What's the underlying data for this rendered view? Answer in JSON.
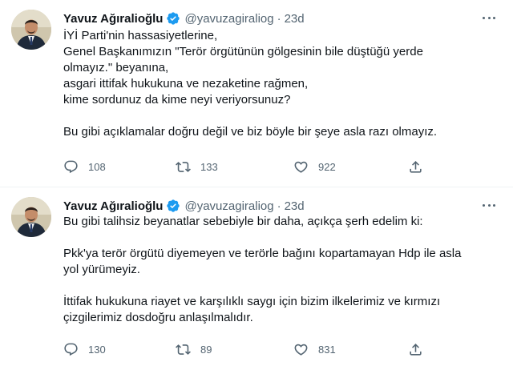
{
  "accent_color": "#1d9bf0",
  "tweets": [
    {
      "author": {
        "name": "Yavuz Ağıralioğlu",
        "handle": "@yavuzagiraliog",
        "verified_icon": "verified-badge-icon"
      },
      "separator": "·",
      "time": "23d",
      "text_lines": [
        "İYİ Parti'nin hassasiyetlerine,",
        "Genel Başkanımızın \"Terör örgütünün gölgesinin bile düştüğü yerde",
        "olmayız.\" beyanına,",
        "asgari ittifak hukukuna ve nezaketine rağmen,",
        "kime sordunuz da kime neyi veriyorsunuz?",
        "",
        "Bu gibi açıklamalar doğru değil ve biz böyle bir şeye asla razı olmayız."
      ],
      "stats": {
        "replies": "108",
        "retweets": "133",
        "likes": "922"
      }
    },
    {
      "author": {
        "name": "Yavuz Ağıralioğlu",
        "handle": "@yavuzagiraliog",
        "verified_icon": "verified-badge-icon"
      },
      "separator": "·",
      "time": "23d",
      "text_lines": [
        "Bu gibi talihsiz beyanatlar sebebiyle bir daha, açıkça şerh edelim ki:",
        "",
        "Pkk'ya terör örgütü diyemeyen ve terörle bağını kopartamayan Hdp ile asla",
        "yol yürümeyiz.",
        "",
        "İttifak hukukuna riayet ve karşılıklı saygı için bizim ilkelerimiz ve kırmızı",
        "çizgilerimiz dosdoğru anlaşılmalıdır."
      ],
      "stats": {
        "replies": "130",
        "retweets": "89",
        "likes": "831"
      }
    }
  ]
}
